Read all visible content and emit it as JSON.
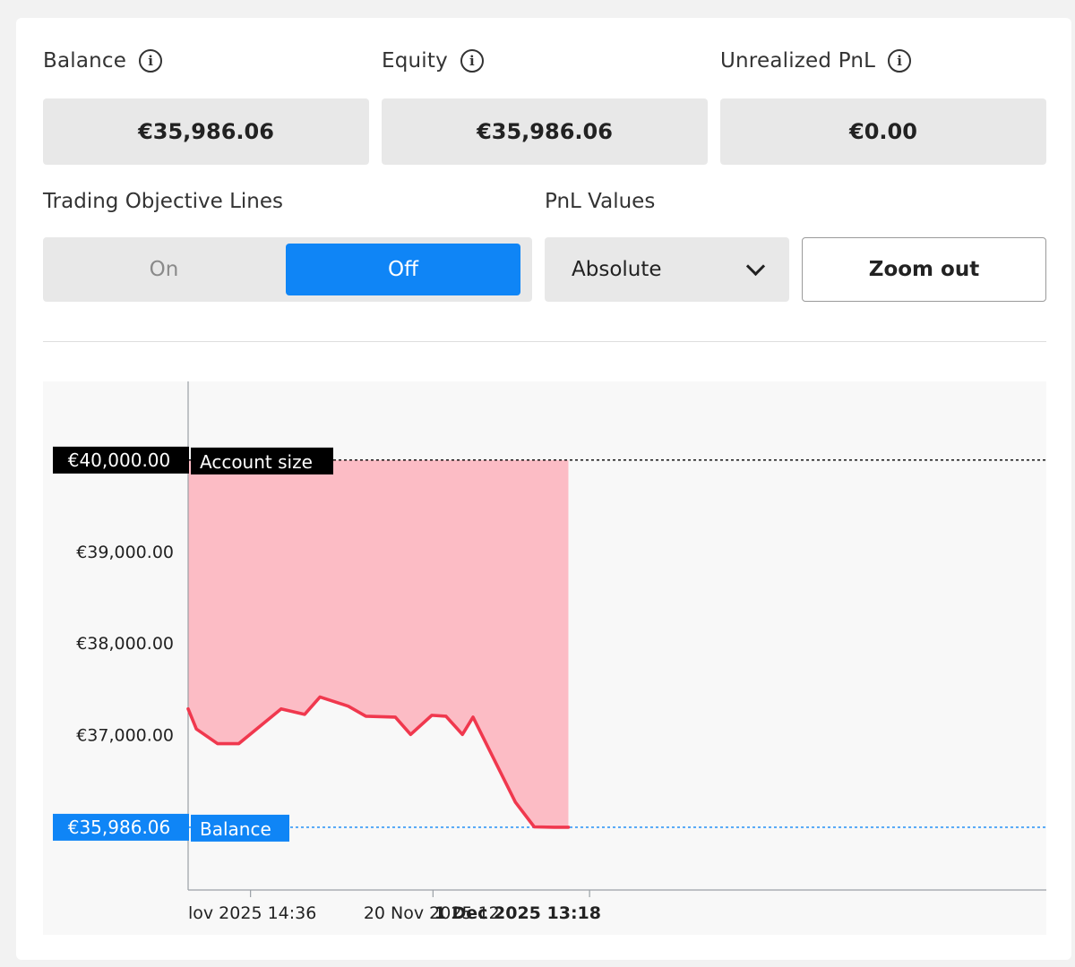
{
  "stats": {
    "balance": {
      "label": "Balance",
      "value": "€35,986.06"
    },
    "equity": {
      "label": "Equity",
      "value": "€35,986.06"
    },
    "unrealized": {
      "label": "Unrealized PnL",
      "value": "€0.00"
    }
  },
  "icons": {
    "info": "info-circle-icon",
    "dropdown": "chevron-down-icon"
  },
  "controls": {
    "objective_lines": {
      "label": "Trading Objective Lines",
      "on": "On",
      "off": "Off",
      "selected": "Off"
    },
    "pnl_values": {
      "label": "PnL Values",
      "selected": "Absolute"
    },
    "zoom_out": "Zoom out"
  },
  "colors": {
    "accent": "#0f85f6",
    "balance_line": "#f0384e",
    "drawdown_fill": "#fcbcc5",
    "account_tag": "#000000",
    "balance_tag": "#0f85f6"
  },
  "chart_data": {
    "type": "line",
    "y_ticks": [
      {
        "value": 39000,
        "label": "€39,000.00"
      },
      {
        "value": 38000,
        "label": "€38,000.00"
      },
      {
        "value": 37000,
        "label": "€37,000.00"
      }
    ],
    "x_ticks": [
      {
        "label": "lov 2025 14:36",
        "bold": false
      },
      {
        "label": "20 Nov 2025 12:",
        "bold": false
      },
      {
        "label": "1 Dec 2025 13:18",
        "bold": true
      }
    ],
    "reference_lines": [
      {
        "name": "Account size",
        "value": 40000,
        "label": "€40,000.00",
        "style": "dotted",
        "color": "#000000"
      },
      {
        "name": "Balance",
        "value": 35986.06,
        "label": "€35,986.06",
        "style": "dotted",
        "color": "#0f85f6"
      }
    ],
    "series": [
      {
        "x": [
          0,
          0.7,
          2.5,
          4.3,
          7.9,
          9.9,
          11.2,
          13.6,
          15.1,
          17.6,
          18.9,
          20.7,
          21.9,
          23.3,
          24.2,
          27.8,
          29.4,
          31.1,
          32.3
        ],
        "values": [
          37280,
          37060,
          36900,
          36900,
          37280,
          37220,
          37410,
          37310,
          37200,
          37190,
          37000,
          37210,
          37200,
          37000,
          37190,
          36260,
          35990,
          35986.06,
          35986.06
        ]
      }
    ],
    "ylim": [
      35300,
      40860
    ],
    "xlim": [
      0,
      72.9
    ],
    "fill_between": {
      "upper": 40000,
      "to_x": 32.3
    },
    "grid": false
  }
}
